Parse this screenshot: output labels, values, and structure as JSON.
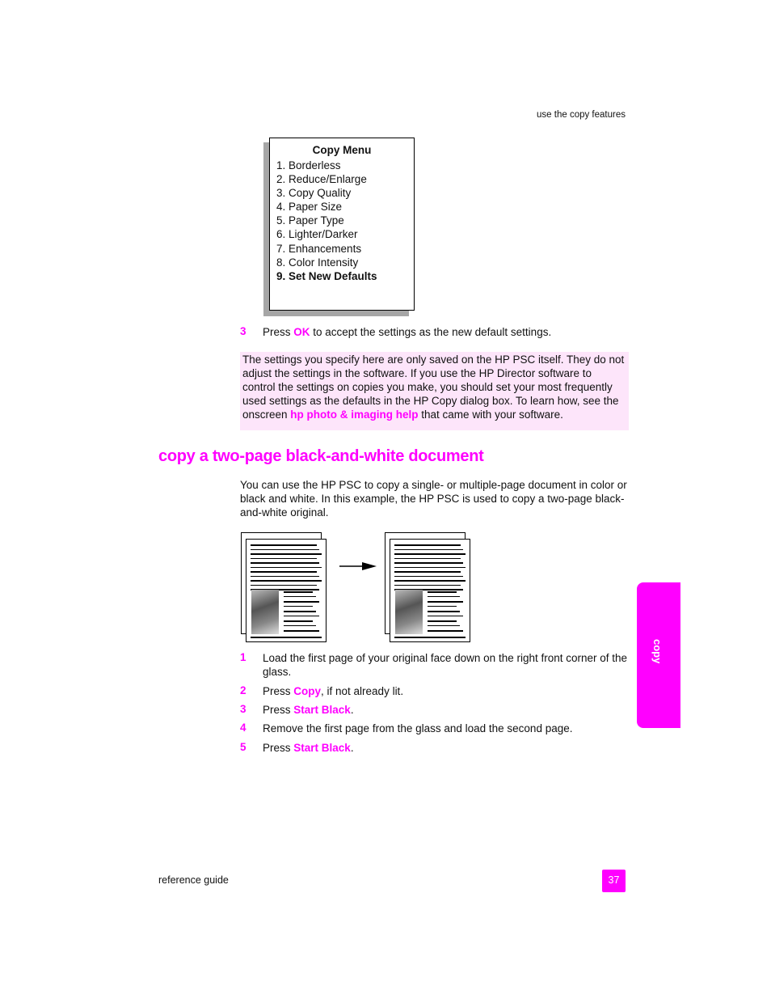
{
  "header": {
    "section_label": "use the copy features"
  },
  "copy_menu": {
    "title": "Copy Menu",
    "items": [
      "1. Borderless",
      "2. Reduce/Enlarge",
      "3. Copy Quality",
      "4. Paper Size",
      "5. Paper Type",
      "6. Lighter/Darker",
      "7. Enhancements",
      "8. Color Intensity",
      "9. Set New Defaults"
    ],
    "selected_index": 8
  },
  "prev_step": {
    "number": "3",
    "before": "Press ",
    "key": "OK",
    "after": " to accept the settings as the new default settings."
  },
  "note": {
    "text_before": "The settings you specify here are only saved on the HP PSC itself. They do not adjust the settings in the software. If you use the HP Director software to control the settings on copies you make, you should set your most frequently used settings as the defaults in the HP Copy dialog box. To learn how, see the onscreen ",
    "link": "hp photo & imaging help",
    "text_after": " that came with your software."
  },
  "section": {
    "title": "copy a two-page black-and-white document",
    "intro": "You can use the HP PSC to copy a single- or multiple-page document in color or black and white. In this example, the HP PSC is used to copy a two-page black-and-white original."
  },
  "figure": {
    "description": "two-page original copied to two-page output",
    "icon": "arrow-right-icon"
  },
  "steps": [
    {
      "number": "1",
      "text": "Load the first page of your original face down on the right front corner of the glass.",
      "key": "",
      "suffix": ""
    },
    {
      "number": "2",
      "text": "Press ",
      "key": "Copy",
      "suffix": ", if not already lit."
    },
    {
      "number": "3",
      "text": "Press ",
      "key": "Start Black",
      "suffix": "."
    },
    {
      "number": "4",
      "text": "Remove the first page from the glass and load the second page.",
      "key": "",
      "suffix": ""
    },
    {
      "number": "5",
      "text": "Press ",
      "key": "Start Black",
      "suffix": "."
    }
  ],
  "side_tab": {
    "label": "copy"
  },
  "footer": {
    "left": "reference guide",
    "page_number": "37"
  },
  "colors": {
    "accent": "#ff00ff",
    "note_bg": "#fde5fa",
    "shadow": "#a6a6a6"
  }
}
